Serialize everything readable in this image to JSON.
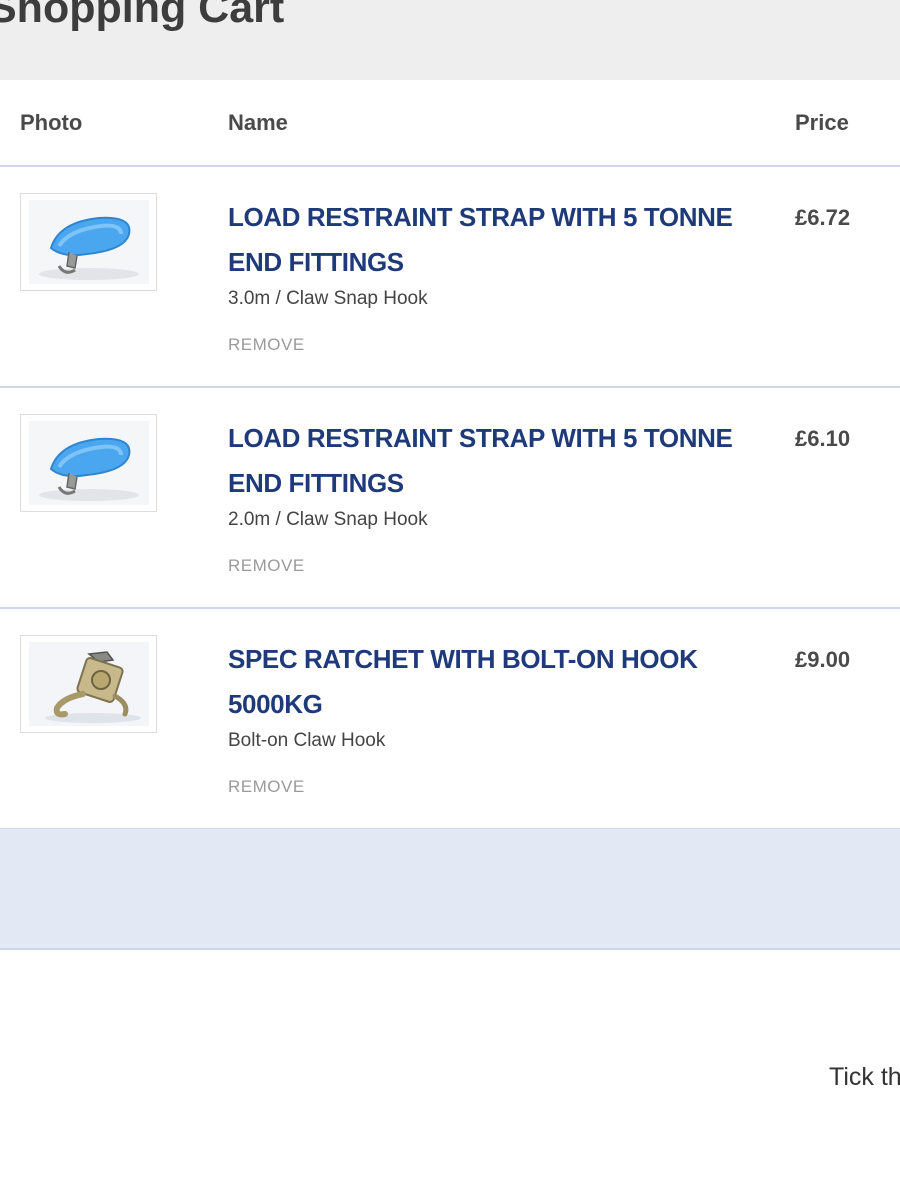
{
  "page": {
    "title": "Shopping Cart"
  },
  "table": {
    "headers": {
      "photo": "Photo",
      "name": "Name",
      "price": "Price"
    },
    "items": [
      {
        "name": "LOAD RESTRAINT STRAP WITH 5 TONNE END FITTINGS",
        "variant": "3.0m / Claw Snap Hook",
        "remove": "REMOVE",
        "price": "£6.72",
        "image_icon": "blue-strap-icon"
      },
      {
        "name": "LOAD RESTRAINT STRAP WITH 5 TONNE END FITTINGS",
        "variant": "2.0m / Claw Snap Hook",
        "remove": "REMOVE",
        "price": "£6.10",
        "image_icon": "blue-strap-icon"
      },
      {
        "name": "SPEC RATCHET WITH BOLT-ON HOOK 5000KG",
        "variant": "Bolt-on Claw Hook",
        "remove": "REMOVE",
        "price": "£9.00",
        "image_icon": "ratchet-hook-icon"
      }
    ]
  },
  "footer": {
    "tick_text": "Tick th"
  },
  "colors": {
    "product_name": "#1f3a7a",
    "header_bg": "#eeeeee",
    "summary_bg": "#e2e8f4",
    "divider": "#cfd8ea"
  }
}
